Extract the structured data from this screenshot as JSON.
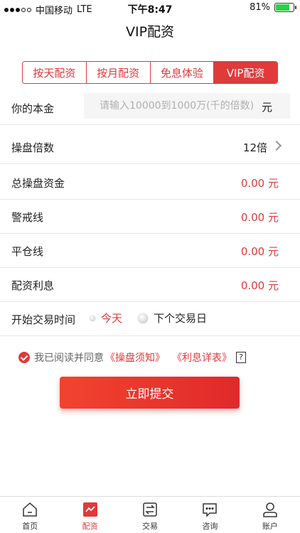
{
  "status_bar": {
    "carrier": "中国移动",
    "network": "LTE",
    "time": "下午8:47",
    "battery": "81%",
    "battery_level": 0.81
  },
  "nav": {
    "title": "VIP配资"
  },
  "segments": [
    {
      "label": "按天配资",
      "active": false
    },
    {
      "label": "按月配资",
      "active": false
    },
    {
      "label": "免息体验",
      "active": false
    },
    {
      "label": "VIP配资",
      "active": true
    }
  ],
  "principal": {
    "label": "你的本金",
    "placeholder": "请输入10000到1000万(千的倍数)",
    "unit": "元"
  },
  "multiplier": {
    "label": "操盘倍数",
    "value": "12倍"
  },
  "total_fund": {
    "label": "总操盘资金",
    "value": "0.00 元"
  },
  "warning_line": {
    "label": "警戒线",
    "value": "0.00 元"
  },
  "close_line": {
    "label": "平仓线",
    "value": "0.00 元"
  },
  "interest": {
    "label": "配资利息",
    "value": "0.00 元"
  },
  "start_time": {
    "label": "开始交易时间",
    "option_today": "今天",
    "option_next": "下个交易日"
  },
  "agreement": {
    "text": "我已阅读并同意",
    "link1": "《操盘须知》",
    "link2": "《利息详表》",
    "help": "?"
  },
  "submit": {
    "label": "立即提交"
  },
  "tabs": [
    {
      "label": "首页",
      "active": false
    },
    {
      "label": "配资",
      "active": true
    },
    {
      "label": "交易",
      "active": false
    },
    {
      "label": "咨询",
      "active": false
    },
    {
      "label": "账户",
      "active": false
    }
  ],
  "colors": {
    "accent": "#e03a3a",
    "battery": "#2bd047"
  }
}
